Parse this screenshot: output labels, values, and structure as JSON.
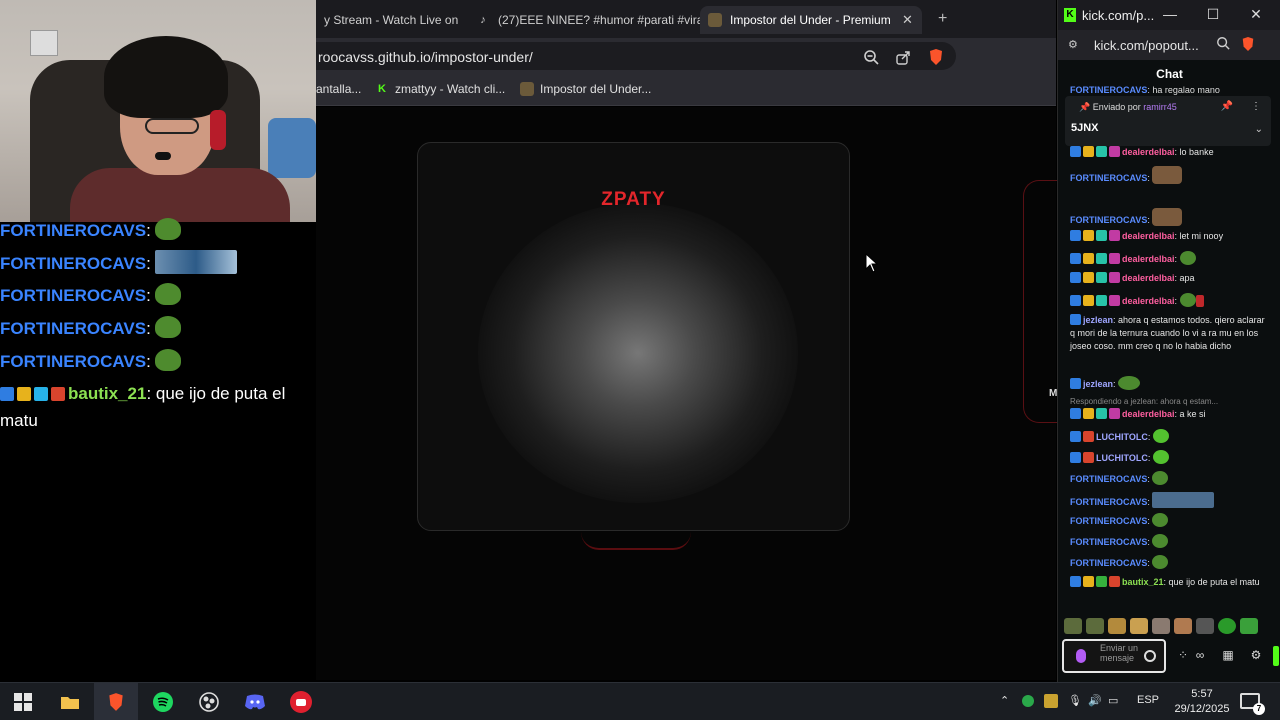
{
  "browser": {
    "tabs": [
      {
        "label": "y Stream - Watch Live on K"
      },
      {
        "label": "(27)EEE NINEE? #humor #parati #vira"
      },
      {
        "label": "Impostor del Under - Premium E"
      }
    ],
    "url": "roocavss.github.io/impostor-under/",
    "bookmarks": [
      {
        "label": "antalla..."
      },
      {
        "label": "zmattyy - Watch cli..."
      },
      {
        "label": "Impostor del Under..."
      }
    ]
  },
  "game": {
    "card_title": "ZPATY",
    "side_label": "M"
  },
  "kick": {
    "window_title": "kick.com/p...",
    "address": "kick.com/popout...",
    "chat_title": "Chat",
    "pinned": {
      "by_prefix": "Enviado por",
      "by_user": "ramirr45",
      "text": "5JNX"
    },
    "messages": [
      {
        "user": "FORTINEROCAVS",
        "text": "ha regalao mano"
      },
      {
        "user": "dealerdelbai",
        "text": "lo banke"
      },
      {
        "user": "FORTINEROCAVS",
        "text": ""
      },
      {
        "user": "FORTINEROCAVS",
        "text": ""
      },
      {
        "user": "dealerdelbai",
        "text": "let mi nooy"
      },
      {
        "user": "dealerdelbai",
        "text": ""
      },
      {
        "user": "dealerdelbai",
        "text": "apa"
      },
      {
        "user": "dealerdelbai",
        "text": ""
      },
      {
        "user": "jezlean",
        "text": "ahora q estamos todos. qiero aclarar q mori de la ternura cuando lo vi a ra mu en los joseo coso. mm creo q no lo habia dicho"
      },
      {
        "user": "jezlean",
        "text": ""
      },
      {
        "user": "dealerdelbai",
        "text": "a ke si",
        "reply": "Respondiendo a jezlean: ahora q estam..."
      },
      {
        "user": "LUCHITOLC",
        "text": ""
      },
      {
        "user": "LUCHITOLC",
        "text": ""
      },
      {
        "user": "FORTINEROCAVS",
        "text": ""
      },
      {
        "user": "FORTINEROCAVS",
        "text": ""
      },
      {
        "user": "FORTINEROCAVS",
        "text": ""
      },
      {
        "user": "FORTINEROCAVS",
        "text": ""
      },
      {
        "user": "FORTINEROCAVS",
        "text": ""
      },
      {
        "user": "bautix_21",
        "text": "que ijo de puta el matu"
      }
    ],
    "input_placeholder": "Enviar un mensaje"
  },
  "stream_chat": {
    "lines": [
      {
        "user": "FORTINEROCAVS"
      },
      {
        "user": "FORTINEROCAVS"
      },
      {
        "user": "FORTINEROCAVS"
      },
      {
        "user": "FORTINEROCAVS"
      },
      {
        "user": "FORTINEROCAVS"
      }
    ],
    "last": {
      "user": "bautix_21",
      "text": "que ijo de puta el matu"
    }
  },
  "taskbar": {
    "language": "ESP",
    "time": "5:57",
    "date": "29/12/2025",
    "notifications": "7"
  },
  "colors": {
    "kick_green": "#53fc18",
    "game_title_red": "#e3262b",
    "chat_user_blue": "#3a84ff"
  }
}
